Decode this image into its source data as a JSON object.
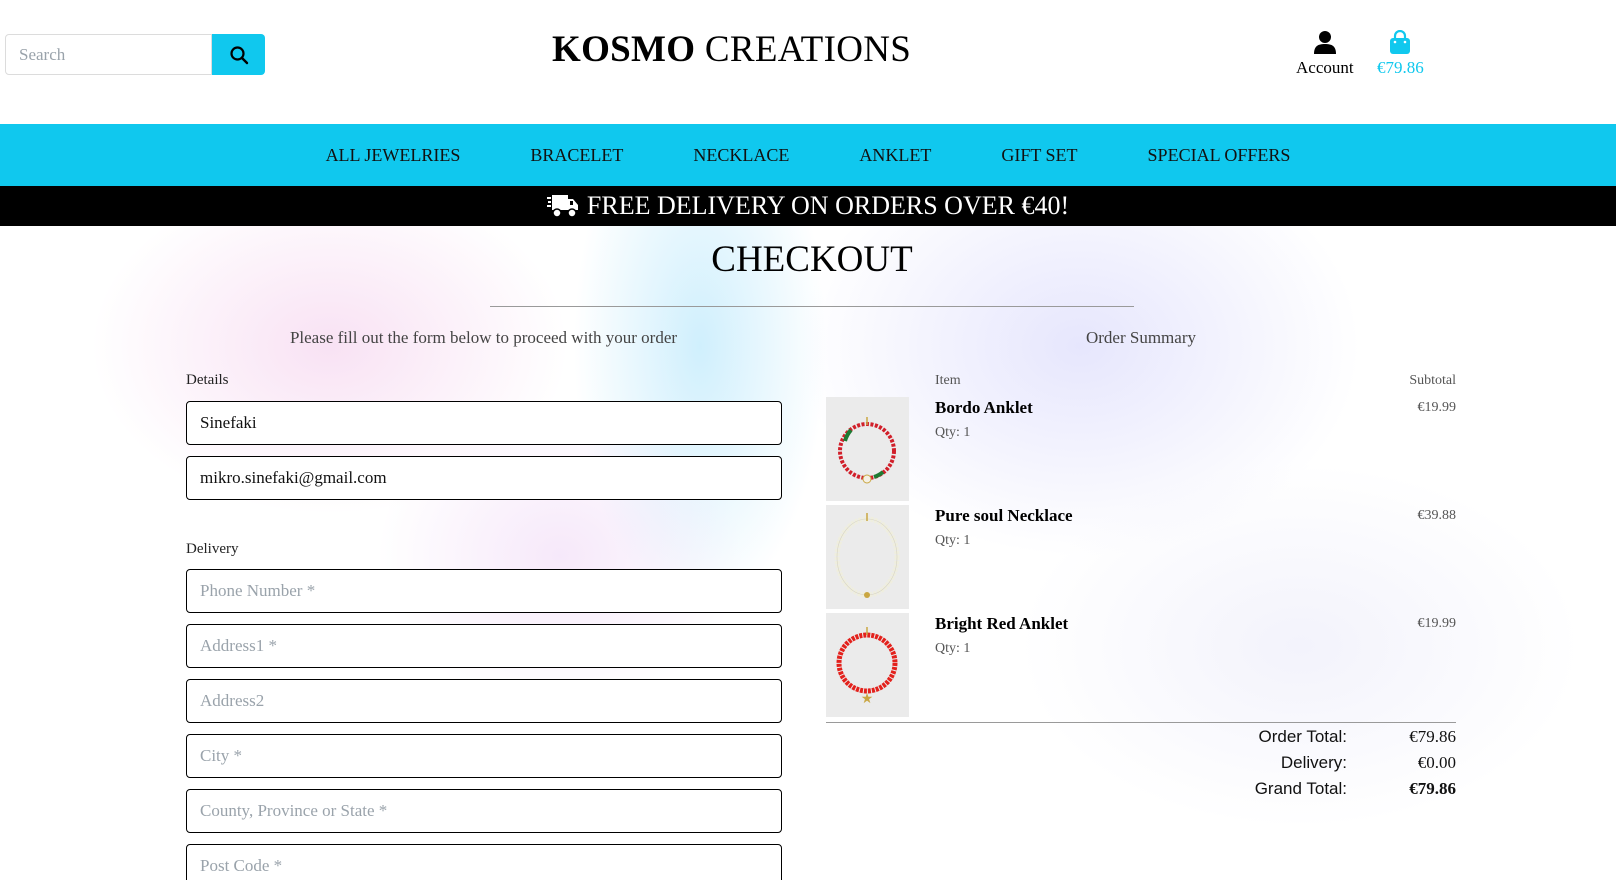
{
  "header": {
    "search_placeholder": "Search",
    "brand_bold": "KOSMO",
    "brand_rest": " CREATIONS",
    "account_label": "Account",
    "cart_total": "€79.86"
  },
  "nav": {
    "items": [
      "ALL JEWELRIES",
      "BRACELET",
      "NECKLACE",
      "ANKLET",
      "GIFT SET",
      "SPECIAL OFFERS"
    ]
  },
  "banner": {
    "text": "FREE DELIVERY ON ORDERS OVER €40!"
  },
  "checkout": {
    "title": "CHECKOUT",
    "form_intro": "Please fill out the form below to proceed with your order",
    "summary_title": "Order Summary"
  },
  "form": {
    "details_label": "Details",
    "full_name": "Sinefaki",
    "email": "mikro.sinefaki@gmail.com",
    "delivery_label": "Delivery",
    "phone_placeholder": "Phone Number *",
    "address1_placeholder": "Address1 *",
    "address2_placeholder": "Address2",
    "city_placeholder": "City *",
    "county_placeholder": "County, Province or State *",
    "postcode_placeholder": "Post Code *"
  },
  "summary": {
    "col_item": "Item",
    "col_subtotal": "Subtotal",
    "items": [
      {
        "name": "Bordo Anklet",
        "qty": "Qty: 1",
        "price": "€19.99",
        "bead_color": "#d11f2a",
        "accent_color": "#1e7a33"
      },
      {
        "name": "Pure soul Necklace",
        "qty": "Qty: 1",
        "price": "€39.88",
        "bead_color": "#efeede",
        "accent_color": "#c9a642"
      },
      {
        "name": "Bright Red Anklet",
        "qty": "Qty: 1",
        "price": "€19.99",
        "bead_color": "#e3211c",
        "accent_color": "#c9a642"
      }
    ],
    "order_total_label": "Order Total:",
    "order_total": "€79.86",
    "delivery_label": "Delivery:",
    "delivery": "€0.00",
    "grand_total_label": "Grand Total:",
    "grand_total": "€79.86"
  },
  "colors": {
    "accent": "#10c8ee",
    "banner": "#000000"
  }
}
